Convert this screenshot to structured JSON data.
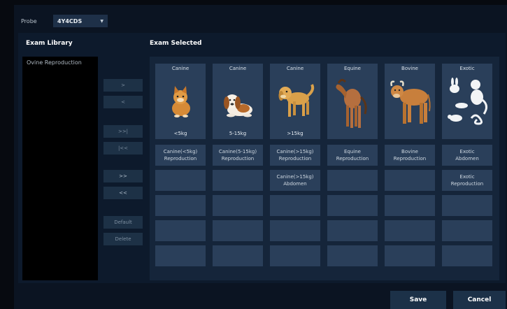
{
  "probe": {
    "label": "Probe",
    "value": "4Y4CDS"
  },
  "library": {
    "title": "Exam Library",
    "items": [
      "Ovine Reproduction"
    ]
  },
  "selected": {
    "title": "Exam Selected"
  },
  "buttons": {
    "move_right": ">",
    "move_left": "<",
    "move_last": ">>|",
    "move_first": "|<<",
    "move_all_right": ">>",
    "move_all_left": "<<",
    "default": "Default",
    "delete": "Delete",
    "save": "Save",
    "cancel": "Cancel"
  },
  "animals": [
    {
      "top": "Canine",
      "bottom": "<5kg",
      "icon": "small-dog-icon"
    },
    {
      "top": "Canine",
      "bottom": "5-15kg",
      "icon": "medium-dog-icon"
    },
    {
      "top": "Canine",
      "bottom": ">15kg",
      "icon": "large-dog-icon"
    },
    {
      "top": "Equine",
      "bottom": "",
      "icon": "horse-icon"
    },
    {
      "top": "Bovine",
      "bottom": "",
      "icon": "cow-icon"
    },
    {
      "top": "Exotic",
      "bottom": "",
      "icon": "exotic-animals-icon"
    }
  ],
  "exam_grid": [
    [
      "Canine(<5kg)\nReproduction",
      "Canine(5-15kg)\nReproduction",
      "Canine(>15kg)\nReproduction",
      "Equine\nReproduction",
      "Bovine\nReproduction",
      "Exotic\nAbdomen"
    ],
    [
      "",
      "",
      "Canine(>15kg)\nAbdomen",
      "",
      "",
      "Exotic\nReproduction"
    ],
    [
      "",
      "",
      "",
      "",
      "",
      ""
    ],
    [
      "",
      "",
      "",
      "",
      "",
      ""
    ],
    [
      "",
      "",
      "",
      "",
      "",
      ""
    ]
  ]
}
